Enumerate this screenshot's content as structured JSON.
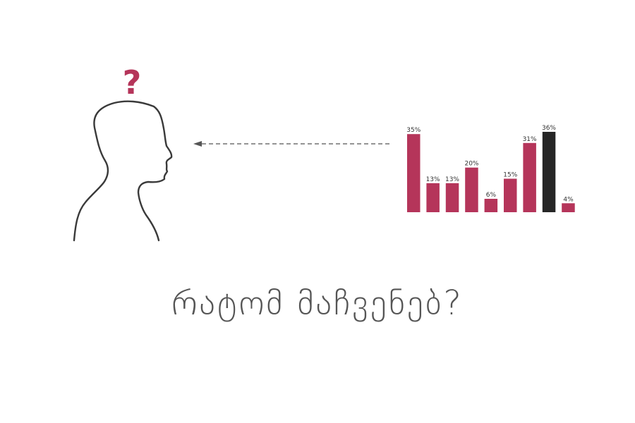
{
  "diagram": {
    "question_mark": "?",
    "caption": "რატომ მაჩვენებ?",
    "colors": {
      "accent": "#b5355a",
      "highlight": "#262626",
      "outline": "#3a3a3a",
      "arrow": "#555555",
      "caption": "#555555"
    }
  },
  "chart_data": {
    "type": "bar",
    "values": [
      35,
      13,
      13,
      20,
      6,
      15,
      31,
      36,
      4
    ],
    "data_labels": [
      "35%",
      "13%",
      "13%",
      "20%",
      "6%",
      "15%",
      "31%",
      "36%",
      "4%"
    ],
    "highlight_index": 7,
    "unit": "%",
    "ylim": [
      0,
      36
    ]
  }
}
